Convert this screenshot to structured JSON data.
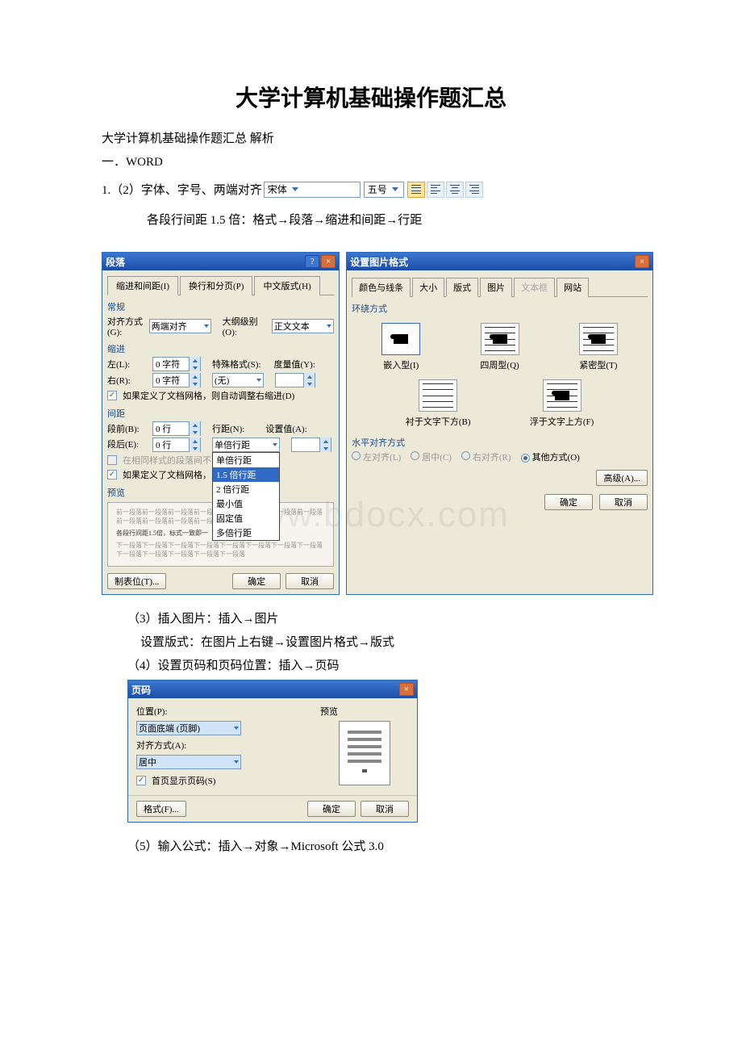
{
  "doc": {
    "title": "大学计算机基础操作题汇总",
    "subtitle": "大学计算机基础操作题汇总 解析",
    "section1": "一．WORD",
    "line1_prefix": "1.（2）字体、字号、两端对齐",
    "font_name": "宋体",
    "font_size": "五号",
    "line2": "各段行间距 1.5 倍：格式→段落→缩进和间距→行距",
    "line3": "（3）插入图片：插入→图片",
    "line4": "设置版式：在图片上右键→设置图片格式→版式",
    "line5": "（4）设置页码和页码位置：插入→页码",
    "line6": "（5）输入公式：插入→对象→Microsoft 公式 3.0"
  },
  "watermark": "www.bdocx.com",
  "paragraph_dialog": {
    "title": "段落",
    "tabs": [
      "缩进和间距(I)",
      "换行和分页(P)",
      "中文版式(H)"
    ],
    "group_general": "常规",
    "align_label": "对齐方式(G):",
    "align_value": "两端对齐",
    "outline_label": "大纲级别(O):",
    "outline_value": "正文文本",
    "group_indent": "缩进",
    "left_label": "左(L):",
    "left_value": "0 字符",
    "right_label": "右(R):",
    "right_value": "0 字符",
    "special_label": "特殊格式(S):",
    "special_value": "(无)",
    "measure_label": "度量值(Y):",
    "auto_indent": "如果定义了文档网格，则自动调整右缩进(D)",
    "group_spacing": "间距",
    "before_label": "段前(B):",
    "before_value": "0 行",
    "after_label": "段后(E):",
    "after_value": "0 行",
    "linespace_label": "行距(N):",
    "linespace_value": "单倍行距",
    "setvalue_label": "设置值(A):",
    "nospacing": "在相同样式的段落间不添加空",
    "snapgrid": "如果定义了文档网格，则对",
    "dropdown_options": [
      "单倍行距",
      "1.5 倍行距",
      "2 倍行距",
      "最小值",
      "固定值",
      "多倍行距"
    ],
    "preview_label": "预览",
    "preview_body1": "前一段落前一段落前一段落前一段落前一段落前一段落前一段落前一段落前一段落前一段落前一段落前一段落前一段落前一段落",
    "preview_body2": "各段行间距1.5倍，标式一致即一",
    "preview_body3": "下一段落下一段落下一段落下一段落下一段落下一段落下一段落下一段落下一段落下一段落下一段落下一段落下一段落",
    "tabstops_btn": "制表位(T)...",
    "ok_btn": "确定",
    "cancel_btn": "取消"
  },
  "picfmt_dialog": {
    "title": "设置图片格式",
    "tabs": [
      "颜色与线条",
      "大小",
      "版式",
      "图片",
      "文本框",
      "网站"
    ],
    "wrap_label": "环绕方式",
    "opts": {
      "inline": "嵌入型(I)",
      "square": "四周型(Q)",
      "tight": "紧密型(T)",
      "behind": "衬于文字下方(B)",
      "front": "浮于文字上方(F)"
    },
    "halign_label": "水平对齐方式",
    "halign_opts": [
      "左对齐(L)",
      "居中(C)",
      "右对齐(R)",
      "其他方式(O)"
    ],
    "advanced_btn": "高级(A)...",
    "ok_btn": "确定",
    "cancel_btn": "取消"
  },
  "pagenum_dialog": {
    "title": "页码",
    "pos_label": "位置(P):",
    "pos_value": "页面底端 (页脚)",
    "align_label": "对齐方式(A):",
    "align_value": "居中",
    "firstpage": "首页显示页码(S)",
    "preview_label": "预览",
    "format_btn": "格式(F)...",
    "ok_btn": "确定",
    "cancel_btn": "取消"
  }
}
